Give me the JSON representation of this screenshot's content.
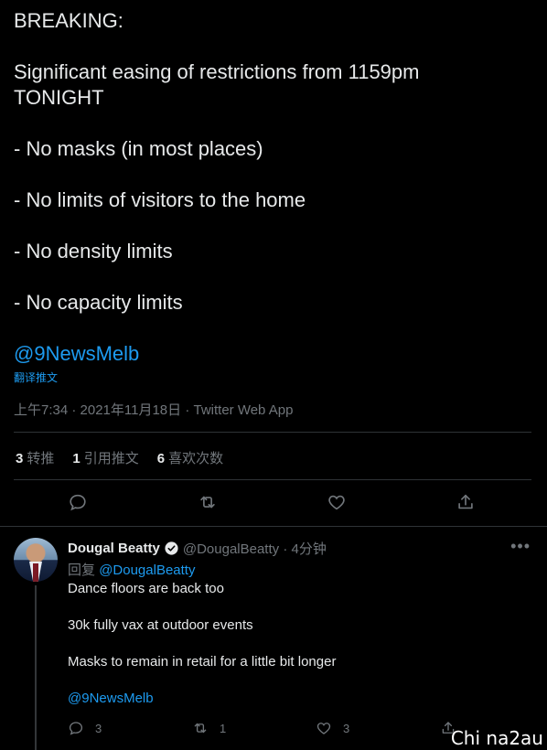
{
  "main_tweet": {
    "lines": [
      "BREAKING:",
      "",
      "Significant easing of restrictions from 1159pm",
      "TONIGHT",
      "",
      "- No masks (in most places)",
      "",
      "- No limits of visitors to the home",
      "",
      "- No density limits",
      "",
      "- No capacity limits",
      "",
      "@9NewsMelb"
    ],
    "translate_label": "翻译推文",
    "meta": "上午7:34 · 2021年11月18日 · Twitter Web App",
    "stats": {
      "retweets_count": "3",
      "retweets_label": "转推",
      "quotes_count": "1",
      "quotes_label": "引用推文",
      "likes_count": "6",
      "likes_label": "喜欢次数"
    }
  },
  "reply": {
    "name": "Dougal Beatty",
    "handle_time": "@DougalBeatty · 4分钟",
    "reply_prefix": "回复",
    "reply_mention": "@DougalBeatty",
    "lines": [
      "Dance floors are back too",
      "",
      "30k fully vax at outdoor events",
      "",
      "Masks to remain in retail for a little bit longer",
      "",
      "@9NewsMelb"
    ],
    "reply_count": "3",
    "retweet_count": "1",
    "like_count": "3"
  },
  "watermark": "Chi na2au",
  "colors": {
    "background": "#000000",
    "text": "#e7e9ea",
    "muted": "#71767b",
    "link": "#1d9bf0",
    "divider": "#2f3336"
  }
}
